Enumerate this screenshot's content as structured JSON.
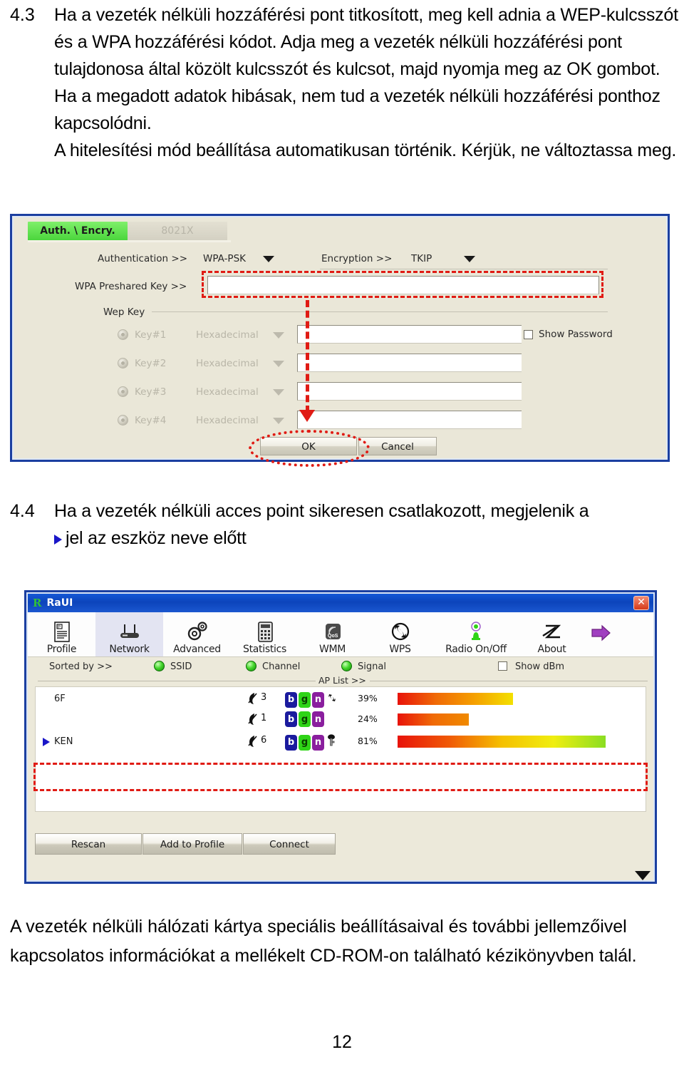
{
  "sections": {
    "s43": {
      "number": "4.3",
      "text": "Ha a vezeték nélküli hozzáférési pont titkosított, meg kell adnia a WEP-kulcsszót és a WPA hozzáférési kódot. Adja meg a vezeték nélküli hozzáférési pont tulajdonosa által közölt kulcsszót és kulcsot, majd nyomja meg az OK gombot. Ha a megadott adatok hibásak, nem tud a vezeték nélküli hozzáférési ponthoz kapcsolódni.",
      "text2": "A hitelesítési mód beállítása automatikusan történik. Kérjük, ne változtassa meg."
    },
    "s44": {
      "number": "4.4",
      "text_before": "Ha a vezeték nélküli acces point sikeresen csatlakozott, megjelenik a",
      "text_after": "jel az eszköz neve előtt"
    },
    "closing": "A vezeték nélküli hálózati kártya speciális beállításaival és további jellemzőivel kapcsolatos információkat a mellékelt CD-ROM-on található kézikönyvben talál.",
    "page_number": "12"
  },
  "auth_dialog": {
    "tabs": [
      {
        "label": "Auth. \\ Encry.",
        "active": true
      },
      {
        "label": "8021X",
        "active": false
      }
    ],
    "authentication_label": "Authentication >>",
    "authentication_value": "WPA-PSK",
    "encryption_label": "Encryption >>",
    "encryption_value": "TKIP",
    "preshared_key_label": "WPA Preshared Key >>",
    "preshared_key_value": "",
    "wep_key_group_label": "Wep Key",
    "show_password_label": "Show Password",
    "show_password_checked": false,
    "wep_keys": [
      {
        "name": "Key#1",
        "format": "Hexadecimal",
        "value": ""
      },
      {
        "name": "Key#2",
        "format": "Hexadecimal",
        "value": ""
      },
      {
        "name": "Key#3",
        "format": "Hexadecimal",
        "value": ""
      },
      {
        "name": "Key#4",
        "format": "Hexadecimal",
        "value": ""
      }
    ],
    "ok_label": "OK",
    "cancel_label": "Cancel",
    "accent_tab_color": "#49d43b",
    "annotation_color": "#e01b14",
    "window_border_color": "#1b3fa0"
  },
  "raui": {
    "title": "RaUI",
    "logo_letter": "R",
    "close_label": "✕",
    "toolbar": [
      {
        "label": "Profile",
        "icon": "profile-icon",
        "selected": false
      },
      {
        "label": "Network",
        "icon": "network-icon",
        "selected": true
      },
      {
        "label": "Advanced",
        "icon": "advanced-icon",
        "selected": false
      },
      {
        "label": "Statistics",
        "icon": "statistics-icon",
        "selected": false
      },
      {
        "label": "WMM",
        "icon": "wmm-qos-icon",
        "selected": false
      },
      {
        "label": "WPS",
        "icon": "wps-icon",
        "selected": false
      },
      {
        "label": "Radio On/Off",
        "icon": "radio-onoff-icon",
        "selected": false
      },
      {
        "label": "About",
        "icon": "about-icon",
        "selected": false
      }
    ],
    "expand_icon": "purple-arrow-icon",
    "sorted_by_label": "Sorted by >>",
    "sort_options": [
      "SSID",
      "Channel",
      "Signal"
    ],
    "show_dbm_label": "Show dBm",
    "show_dbm_checked": false,
    "ap_list_label": "AP List >>",
    "ap_rows": [
      {
        "ssid": "6F",
        "channel": "3",
        "badges": [
          "b",
          "g",
          "n"
        ],
        "extra_icon": "wps-icon",
        "signal": "39%",
        "signal_pct": 39,
        "connected": false
      },
      {
        "ssid": "",
        "channel": "1",
        "badges": [
          "b",
          "g",
          "n"
        ],
        "extra_icon": "",
        "signal": "24%",
        "signal_pct": 24,
        "connected": false
      },
      {
        "ssid": "KEN",
        "channel": "6",
        "badges": [
          "b",
          "g",
          "n"
        ],
        "extra_icon": "lock-icon",
        "signal": "81%",
        "signal_pct": 81,
        "connected": true
      }
    ],
    "buttons": [
      "Rescan",
      "Add to Profile",
      "Connect"
    ],
    "scroll_icon": "scroll-down-icon",
    "window_border_color": "#1b3fa0",
    "titlebar_color": "#0c44bb",
    "selected_tab_bg": "#e3e4f2"
  }
}
